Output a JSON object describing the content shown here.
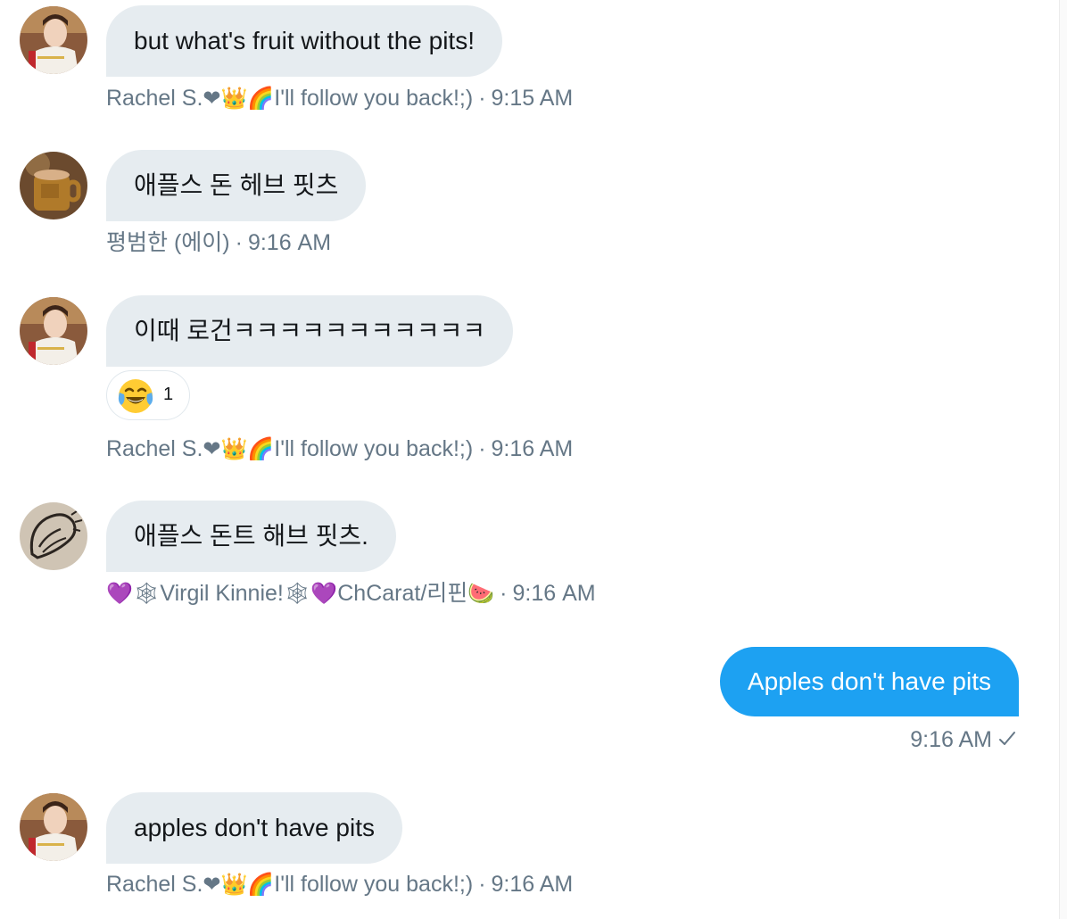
{
  "messages": [
    {
      "text": "but what's fruit without the pits!",
      "sender": "Rachel S.",
      "sender_emoji": "❤👑🌈",
      "sender_suffix": "I'll follow you back!;)",
      "time": "9:15 AM"
    },
    {
      "text": "애플스 돈 헤브 핏츠",
      "sender": "평범한 (에이)",
      "sender_emoji": "",
      "sender_suffix": "",
      "time": "9:16 AM"
    },
    {
      "text": "이때 로건ㅋㅋㅋㅋㅋㅋㅋㅋㅋㅋㅋ",
      "sender": "Rachel S.",
      "sender_emoji": "❤👑🌈",
      "sender_suffix": "I'll follow you back!;)",
      "time": "9:16 AM",
      "reaction": {
        "emoji_name": "face-with-tears-of-joy",
        "count": "1"
      }
    },
    {
      "text": "애플스 돈트 해브 핏츠.",
      "sender_prefix_emoji": "💜🕸",
      "sender": "Virgil Kinnie!",
      "sender_mid_emoji": "🕸💜",
      "sender_suffix": "ChCarat/리핀",
      "sender_end_emoji": "🍉",
      "time": "9:16 AM"
    },
    {
      "text": "apples don't have pits",
      "sender": "Rachel S.",
      "sender_emoji": "❤👑🌈",
      "sender_suffix": "I'll follow you back!;)",
      "time": "9:16 AM"
    }
  ],
  "outgoing": {
    "text": "Apples don't have pits",
    "time": "9:16 AM",
    "status_icon": "checkmark-icon"
  },
  "separator": "·",
  "colors": {
    "bubble_in": "#e6ecf0",
    "bubble_out": "#1da1f2",
    "meta_text": "#657786"
  }
}
